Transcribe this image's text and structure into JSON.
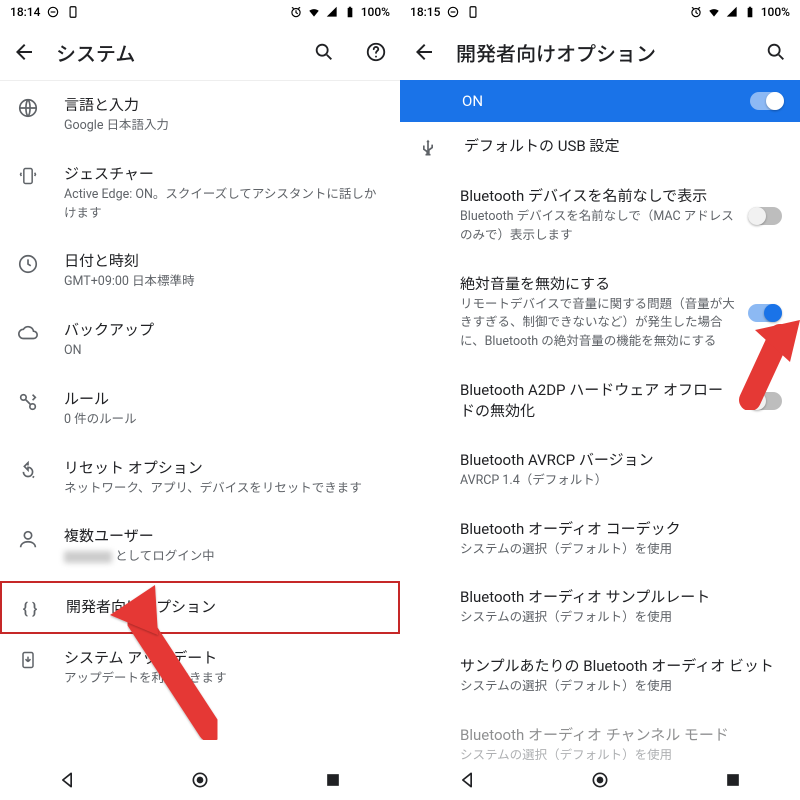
{
  "left": {
    "status": {
      "time": "18:14",
      "battery": "100%"
    },
    "title": "システム",
    "items": [
      {
        "title": "言語と入力",
        "sub": "Google 日本語入力"
      },
      {
        "title": "ジェスチャー",
        "sub": "Active Edge: ON。スクイーズしてアシスタントに話しかけます"
      },
      {
        "title": "日付と時刻",
        "sub": "GMT+09:00 日本標準時"
      },
      {
        "title": "バックアップ",
        "sub": "ON"
      },
      {
        "title": "ルール",
        "sub": "0 件のルール"
      },
      {
        "title": "リセット オプション",
        "sub": "ネットワーク、アプリ、デバイスをリセットできます"
      },
      {
        "title": "複数ユーザー",
        "sub_prefix": "",
        "sub_suffix": "としてログイン中"
      },
      {
        "title": "開発者向けオプション",
        "sub": ""
      },
      {
        "title": "システム アップデート",
        "sub": "アップデートを利用できます"
      }
    ]
  },
  "right": {
    "status": {
      "time": "18:15",
      "battery": "100%"
    },
    "title": "開発者向けオプション",
    "banner": "ON",
    "usb": "デフォルトの USB 設定",
    "items": [
      {
        "title": "Bluetooth デバイスを名前なしで表示",
        "sub": "Bluetooth デバイスを名前なしで（MAC アドレスのみで）表示します",
        "toggle": "off"
      },
      {
        "title": "絶対音量を無効にする",
        "sub": "リモートデバイスで音量に関する問題（音量が大きすぎる、制御できないなど）が発生した場合に、Bluetooth の絶対音量の機能を無効にする",
        "toggle": "on"
      },
      {
        "title": "Bluetooth A2DP ハードウェア オフロードの無効化",
        "sub": "",
        "toggle": "off"
      },
      {
        "title": "Bluetooth AVRCP バージョン",
        "sub": "AVRCP 1.4（デフォルト）"
      },
      {
        "title": "Bluetooth オーディオ コーデック",
        "sub": "システムの選択（デフォルト）を使用"
      },
      {
        "title": "Bluetooth オーディオ サンプルレート",
        "sub": "システムの選択（デフォルト）を使用"
      },
      {
        "title": "サンプルあたりの Bluetooth オーディオ ビット",
        "sub": "システムの選択（デフォルト）を使用"
      },
      {
        "title": "Bluetooth オーディオ チャンネル モード",
        "sub": "システムの選択（デフォルト）を使用"
      }
    ]
  }
}
